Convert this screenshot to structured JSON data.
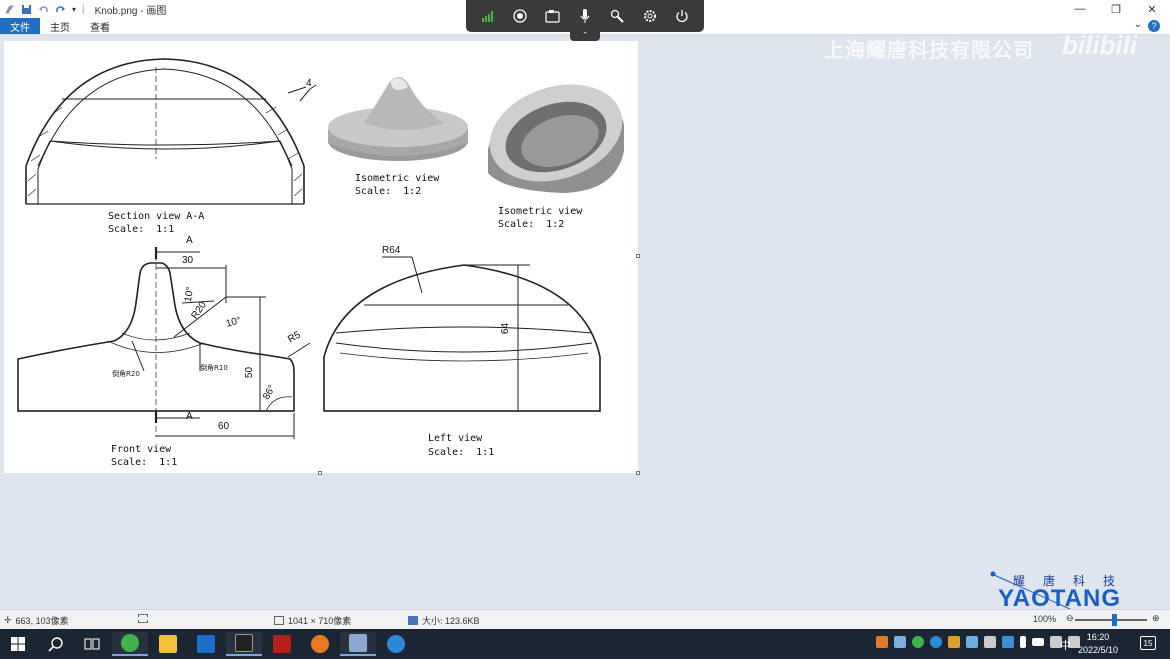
{
  "window": {
    "title": "Knob.png - 画图",
    "tabs": [
      "文件",
      "主页",
      "查看"
    ]
  },
  "watermark": {
    "company_cn": "上海耀唐科技有限公司",
    "bilibili": "bilibili"
  },
  "drawing": {
    "section_view": {
      "title": "Section view A-A",
      "scale": "Scale:  1:1",
      "thickness_dim": "4"
    },
    "iso_view_1": {
      "title": "Isometric view",
      "scale": "Scale:  1:2"
    },
    "iso_view_2": {
      "title": "Isometric view",
      "scale": "Scale:  1:2"
    },
    "front_view": {
      "title": "Front view",
      "scale": "Scale:  1:1",
      "section_marker_top": "A",
      "section_marker_bottom": "A",
      "dim_30": "30",
      "dim_60": "60",
      "dim_50": "50",
      "dim_r20": "R20",
      "dim_r5": "R5",
      "dim_10a": "10°",
      "dim_10b": "10°",
      "dim_86": "86°",
      "fillet_r20": "倒角R20",
      "fillet_r10": "倒角R10"
    },
    "left_view": {
      "title": "Left view",
      "scale": "Scale:  1:1",
      "dim_r64": "R64",
      "dim_64": "64"
    }
  },
  "logo": {
    "cn": "耀唐科技",
    "en": "YAOTANG"
  },
  "statusbar": {
    "cursor_pos": "663, 103像素",
    "image_dims": "1041 × 710像素",
    "file_size": "大小: 123.6KB",
    "zoom": "100%"
  },
  "taskbar": {
    "time": "16:20",
    "date": "2022/5/10",
    "ime": "中",
    "notifications": "15"
  }
}
